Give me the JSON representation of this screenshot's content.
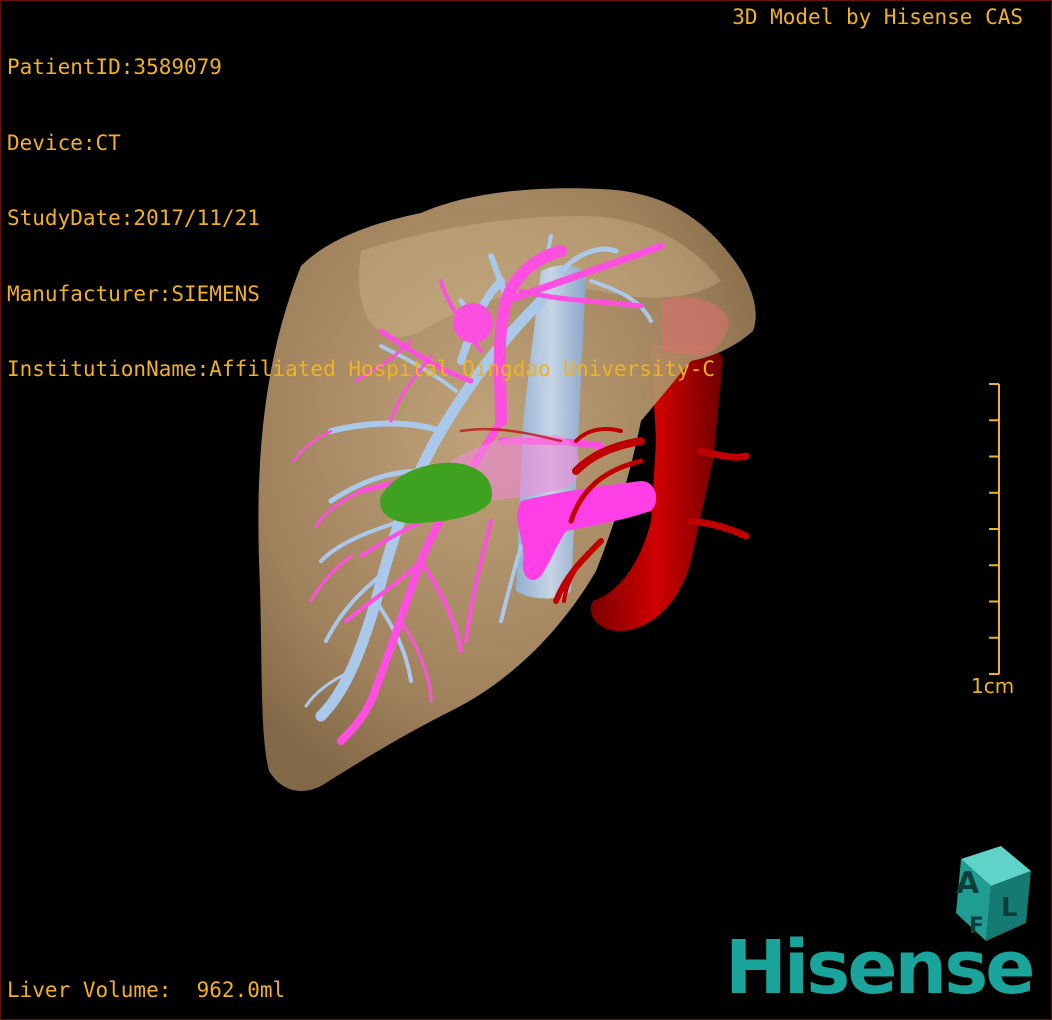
{
  "header": {
    "patient_id": "PatientID:3589079",
    "device": "Device:CT",
    "study_date": "StudyDate:2017/11/21",
    "manufacturer": "Manufacturer:SIEMENS",
    "institution": "InstitutionName:Affiliated Hospital Qingdao University-C"
  },
  "brand_caption": "3D Model by Hisense CAS",
  "scale": {
    "label": "1cm"
  },
  "footer": {
    "liver_volume": "Liver Volume:  962.0ml"
  },
  "logo": {
    "cube_letters": [
      "A",
      "F",
      "L"
    ],
    "wordmark": "Hisense"
  },
  "colors": {
    "overlay_text": "#f2b21f",
    "liver": "#b3946a",
    "portal_vein": "#ff4fe0",
    "hepatic_vein": "#a9c8ea",
    "artery": "#c00000",
    "gallbladder": "#3ea11f",
    "brand": "#19a59b"
  }
}
